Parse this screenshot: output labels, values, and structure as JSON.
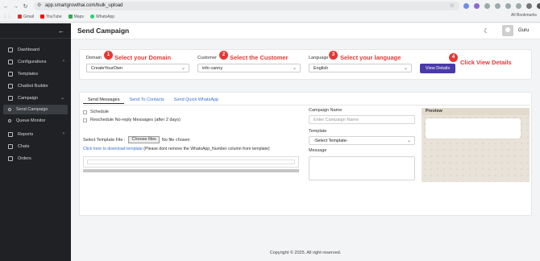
{
  "browser": {
    "url": "app.smartgrowthai.com/bulk_upload",
    "bookmarks": [
      "Gmail",
      "YouTube",
      "Maps",
      "WhatsApp"
    ],
    "all_bookmarks": "All Bookmarks"
  },
  "sidebar": {
    "items": [
      {
        "label": "Dashboard",
        "icon": "dashboard-icon"
      },
      {
        "label": "Configurations",
        "icon": "settings-icon",
        "arrow": "‹"
      },
      {
        "label": "Templates",
        "icon": "templates-icon"
      },
      {
        "label": "Chatbot Builder",
        "icon": "chatbot-icon"
      },
      {
        "label": "Campaign",
        "icon": "campaign-icon",
        "arrow": "⌄"
      },
      {
        "label": "Send Campaign",
        "icon": "circle-icon",
        "active": true
      },
      {
        "label": "Queue Monitor",
        "icon": "circle-icon"
      },
      {
        "label": "Reports",
        "icon": "reports-icon",
        "arrow": "‹"
      },
      {
        "label": "Chats",
        "icon": "chats-icon"
      },
      {
        "label": "Orders",
        "icon": "orders-icon"
      }
    ]
  },
  "header": {
    "title": "Send Campaign",
    "user": "Guru"
  },
  "filters": {
    "domain": {
      "label": "Domain",
      "value": "CreateYourOwn",
      "step": "1",
      "hint": "Select your Domain"
    },
    "customer": {
      "label": "Customer",
      "value": "info canny",
      "step": "2",
      "hint": "Select the Customer"
    },
    "language": {
      "label": "Language",
      "value": "English",
      "step": "3",
      "hint": "Select your language"
    },
    "view": {
      "label": "View Details",
      "step": "4",
      "hint": "Click View Details"
    }
  },
  "tabs": [
    "Send Messages",
    "Send To Contacts",
    "Send Quick WhatsApp"
  ],
  "send_messages": {
    "schedule": "Schedule",
    "reschedule": "Reschedule No-reply Messages (after 2 days)",
    "file_label": "Select Template File :",
    "file_button": "Choose files",
    "file_status": "No file chosen",
    "download_link": "Click here to download template",
    "download_note": "(Please dont remove the WhatsApp_Number column from template)"
  },
  "campaign": {
    "name_label": "Campaign Name",
    "name_placeholder": "Enter Campaign Name",
    "template_label": "Template",
    "template_value": "-Select Template-",
    "message_label": "Message"
  },
  "preview": {
    "title": "Preview"
  },
  "footer": "Copyright © 2025. All right reserved.",
  "colors": {
    "accent": "#4a3aa9",
    "annotation": "#e53935",
    "sidebar": "#1f2124",
    "link": "#3b6fd6"
  }
}
